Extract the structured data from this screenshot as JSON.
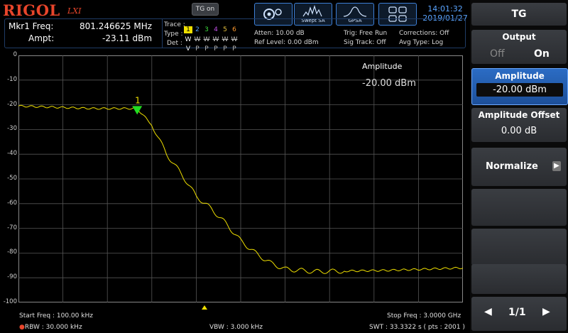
{
  "header": {
    "logo": "RIGOL",
    "logo_sub": "LXI",
    "tg_badge": "TG on",
    "mode_buttons": [
      {
        "icon": "gear-icon",
        "label": ""
      },
      {
        "icon": "spectrum-icon",
        "label": "Swept SA"
      },
      {
        "icon": "gpsa-icon",
        "label": "GPSA"
      },
      {
        "icon": "window-layout-icon",
        "label": ""
      }
    ],
    "time": "14:01:32",
    "date": "2019/01/27"
  },
  "marker": {
    "freq_label": "Mkr1 Freq:",
    "freq_value": "801.246625 MHz",
    "ampt_label": "Ampt:",
    "ampt_value": "-23.11 dBm"
  },
  "trace": {
    "trace_label": "Trace :",
    "numbers": [
      "1",
      "2",
      "3",
      "4",
      "5",
      "6"
    ],
    "type_label": "Type :",
    "types": [
      "W",
      "W",
      "W",
      "W",
      "W",
      "W"
    ],
    "det_label": "Det :",
    "dets": [
      "V",
      "P",
      "P",
      "P",
      "P",
      "P"
    ]
  },
  "settings": {
    "atten": "Atten: 10.00 dB",
    "ref_level": "Ref Level: 0.00 dBm",
    "trig": "Trig: Free Run",
    "sig_track": "Sig Track: Off",
    "corrections": "Corrections: Off",
    "avg_type": "Avg Type: Log"
  },
  "plot": {
    "annotation_title": "Amplitude",
    "annotation_value": "-20.00 dBm",
    "marker_label": "1",
    "start_freq": "Start Freq : 100.00 kHz",
    "stop_freq": "Stop Freq : 3.0000 GHz",
    "rbw": "RBW : 30.000 kHz",
    "vbw": "VBW : 3.000 kHz",
    "swt": "SWT : 33.3322 s ( pts : 2001 )"
  },
  "chart_data": {
    "type": "line",
    "x_range_ghz": [
      0.0001,
      3.0
    ],
    "ylim": [
      -100,
      0
    ],
    "yticks": [
      0,
      -10,
      -20,
      -30,
      -40,
      -50,
      -60,
      -70,
      -80,
      -90,
      -100
    ],
    "grid": true,
    "series": [
      {
        "x": [
          0.0001,
          0.5,
          0.8,
          0.9,
          1.0,
          1.1,
          1.2,
          1.3,
          1.4,
          1.5,
          1.6,
          1.7,
          1.8,
          2.0,
          2.5,
          3.0
        ],
        "values": [
          -20.5,
          -21.5,
          -21.5,
          -28,
          -40,
          -48,
          -57,
          -62,
          -68,
          -75,
          -80,
          -84,
          -86.5,
          -87.5,
          -87,
          -86
        ]
      }
    ],
    "marker": {
      "x": 0.801246625,
      "y": -23.11
    }
  },
  "panel": {
    "title": "TG",
    "output_label": "Output",
    "output_off": "Off",
    "output_on": "On",
    "amplitude_label": "Amplitude",
    "amplitude_value": "-20.00 dBm",
    "offset_label": "Amplitude Offset",
    "offset_value": "0.00 dB",
    "normalize_label": "Normalize",
    "page": "1/1"
  },
  "colors": {
    "trace": "#f0e000",
    "marker": "#22dd22",
    "accent": "#3d7fd6",
    "logo": "#e8452b"
  }
}
